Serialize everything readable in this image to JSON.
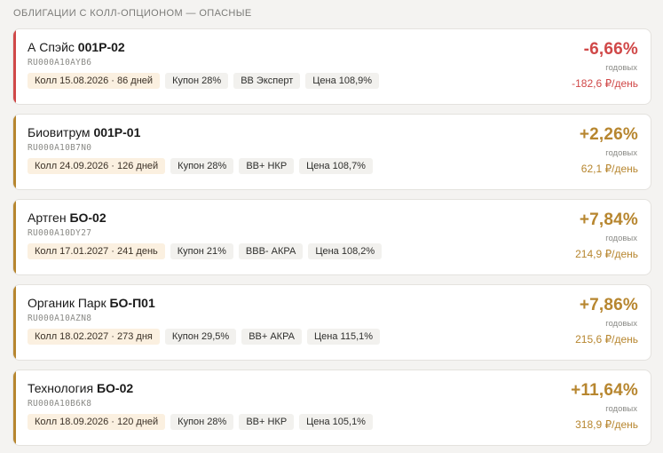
{
  "section": {
    "title": "ОБЛИГАЦИИ С КОЛЛ-ОПЦИОНОМ — ОПАСНЫЕ"
  },
  "colors": {
    "negative": "#d04848",
    "positive": "#b7862f",
    "call_tag_bg": "#fbf0e0",
    "tag_bg": "#f2f1ee"
  },
  "bonds": [
    {
      "issuer": "А Спэйс",
      "series": "001Р-02",
      "isin": "RU000A10AYB6",
      "call": "Колл 15.08.2026 · 86 дней",
      "coupon": "Купон 28%",
      "rating": "BB Эксперт",
      "price": "Цена 108,9%",
      "yield": "-6,66%",
      "yield_unit": "годовых",
      "daily": "-182,6 ₽/день",
      "tone": "negative"
    },
    {
      "issuer": "Биовитрум",
      "series": "001Р-01",
      "isin": "RU000A10B7N0",
      "call": "Колл 24.09.2026 · 126 дней",
      "coupon": "Купон 28%",
      "rating": "BB+ НКР",
      "price": "Цена 108,7%",
      "yield": "+2,26%",
      "yield_unit": "годовых",
      "daily": "62,1 ₽/день",
      "tone": "positive"
    },
    {
      "issuer": "Артген",
      "series": "БО-02",
      "isin": "RU000A10DY27",
      "call": "Колл 17.01.2027 · 241 день",
      "coupon": "Купон 21%",
      "rating": "BBB- АКРА",
      "price": "Цена 108,2%",
      "yield": "+7,84%",
      "yield_unit": "годовых",
      "daily": "214,9 ₽/день",
      "tone": "positive"
    },
    {
      "issuer": "Органик Парк",
      "series": "БО-П01",
      "isin": "RU000A10AZN8",
      "call": "Колл 18.02.2027 · 273 дня",
      "coupon": "Купон 29,5%",
      "rating": "BB+ АКРА",
      "price": "Цена 115,1%",
      "yield": "+7,86%",
      "yield_unit": "годовых",
      "daily": "215,6 ₽/день",
      "tone": "positive"
    },
    {
      "issuer": "Технология",
      "series": "БО-02",
      "isin": "RU000A10B6K8",
      "call": "Колл 18.09.2026 · 120 дней",
      "coupon": "Купон 28%",
      "rating": "BB+ НКР",
      "price": "Цена 105,1%",
      "yield": "+11,64%",
      "yield_unit": "годовых",
      "daily": "318,9 ₽/день",
      "tone": "positive"
    }
  ]
}
